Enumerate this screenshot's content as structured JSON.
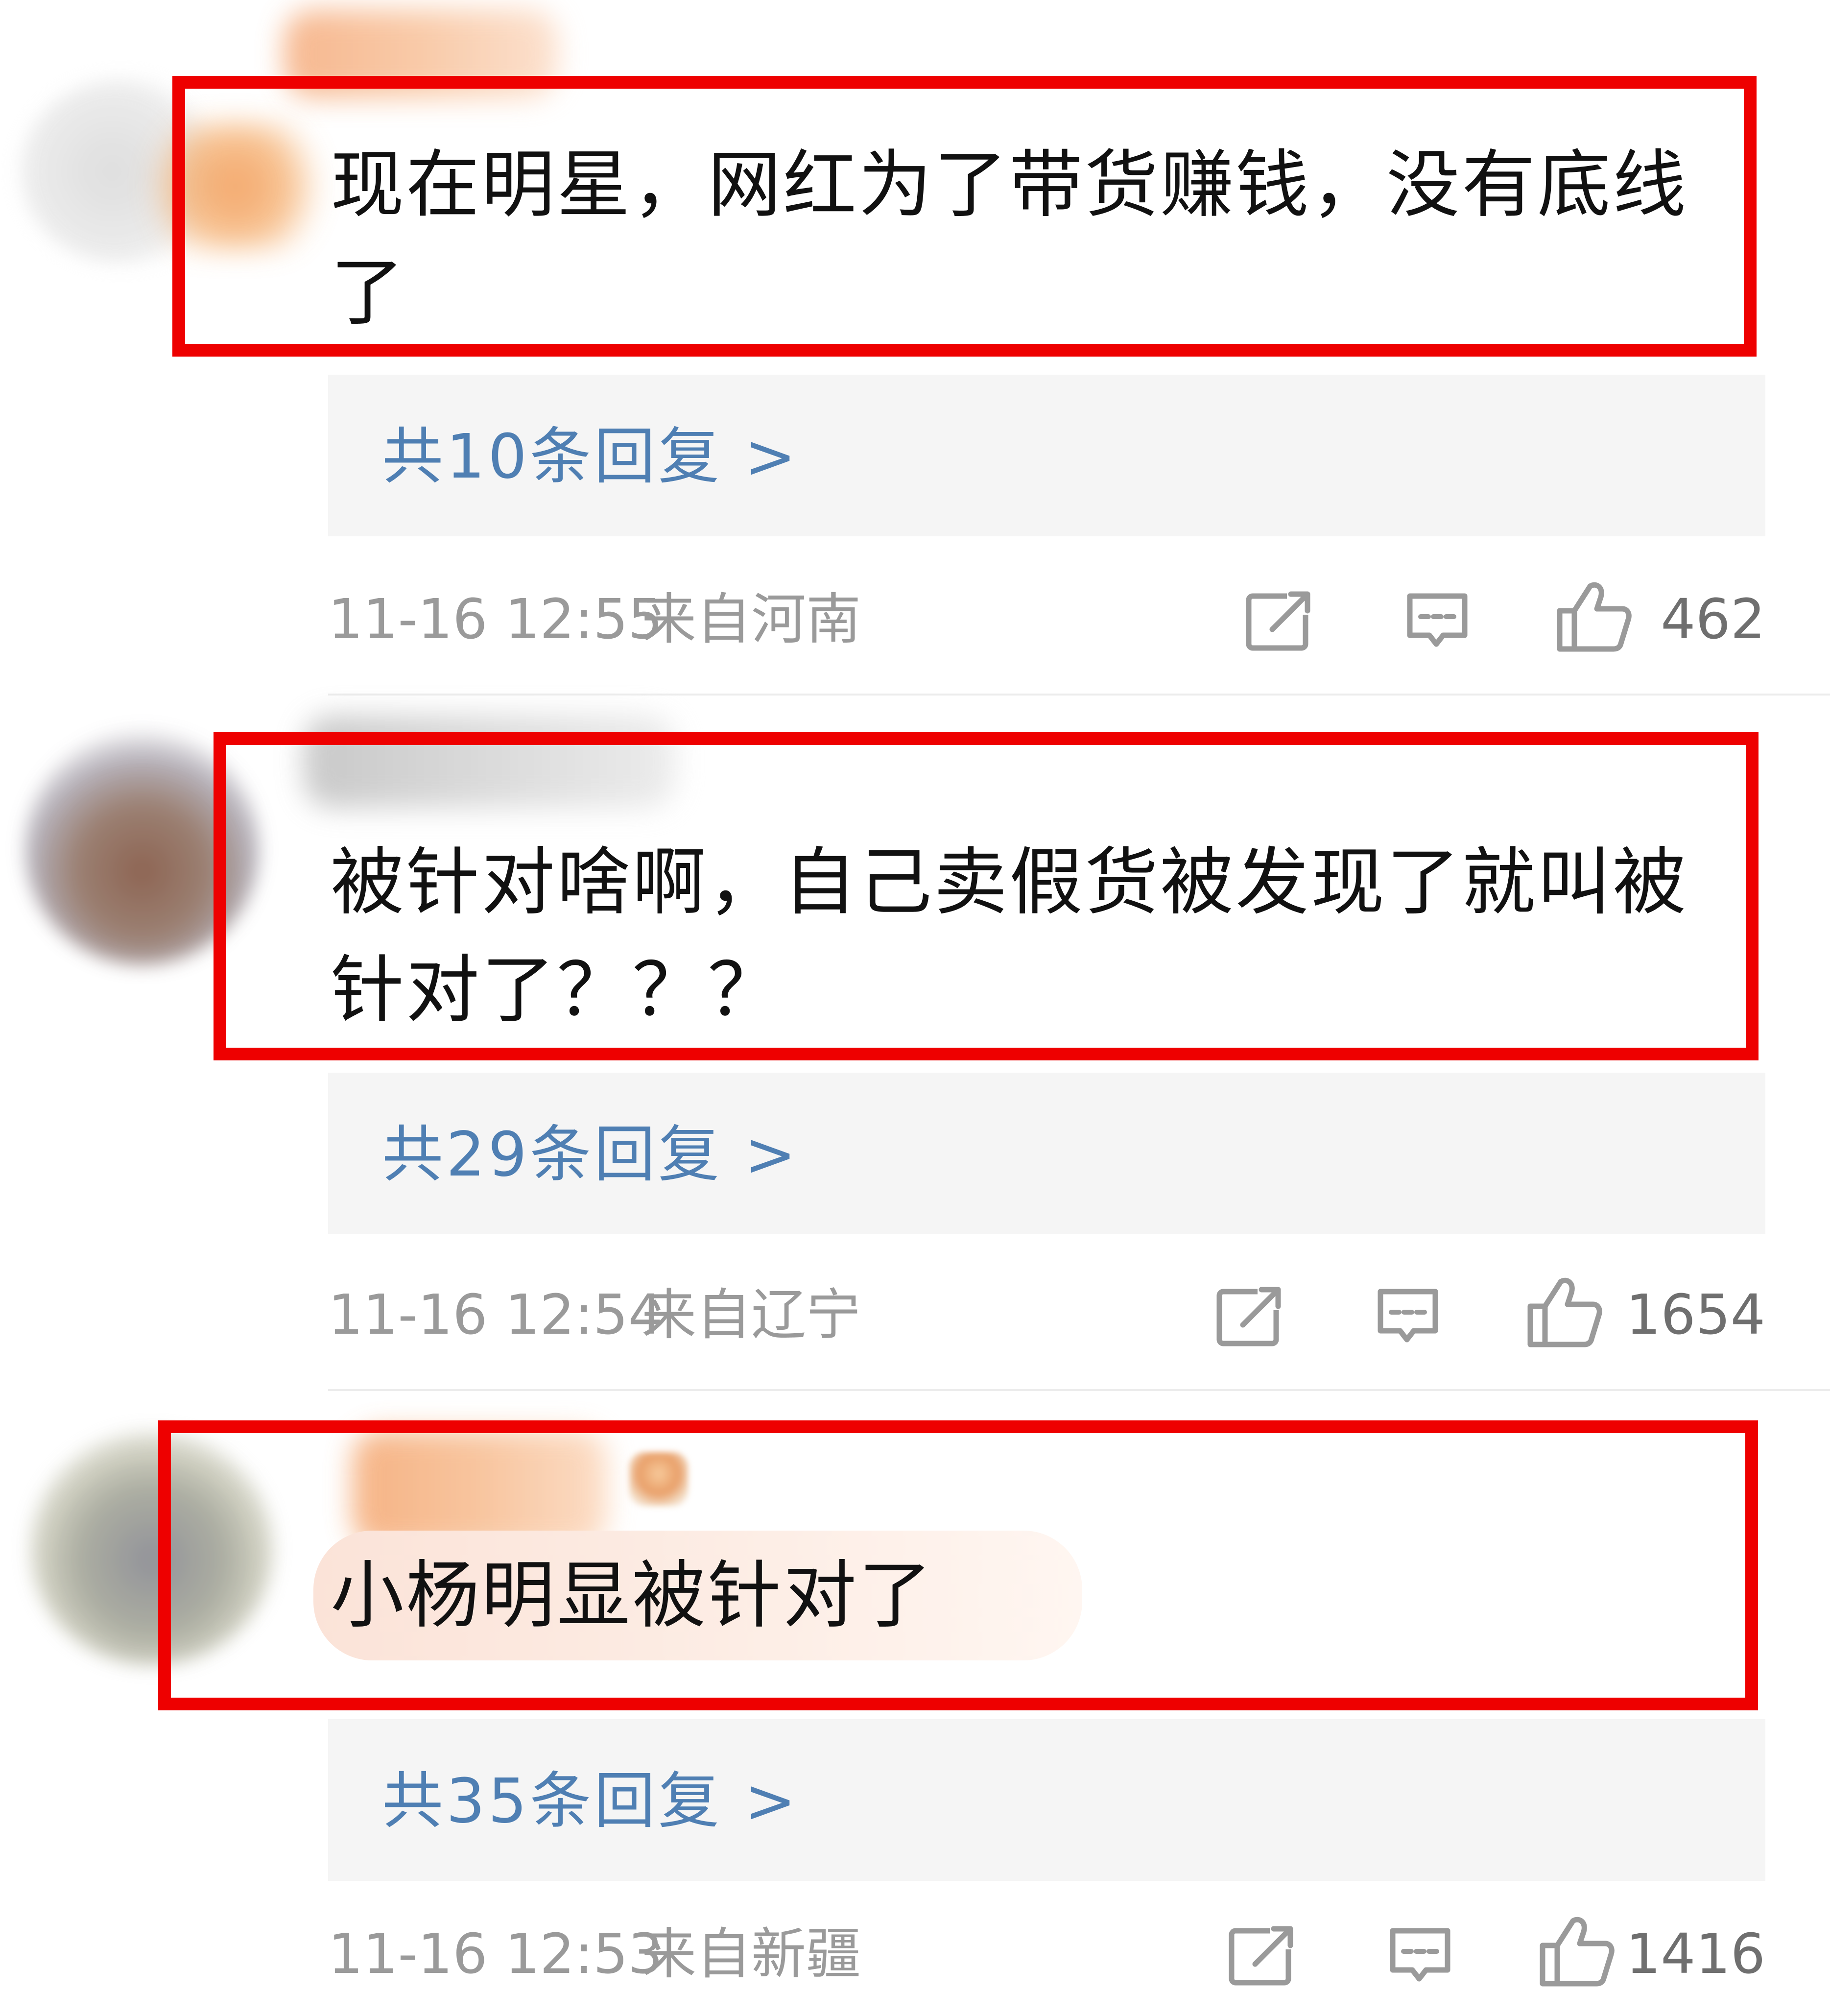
{
  "comments": [
    {
      "text": "现在明星，网红为了带货赚钱，没有底线了",
      "replies_label": "共10条回复 >",
      "time": "11-16 12:55",
      "location": "来自河南",
      "likes": "462",
      "highlighted": true
    },
    {
      "text": "被针对啥啊，自己卖假货被发现了就叫被针对了？？？",
      "replies_label": "共29条回复 >",
      "time": "11-16 12:54",
      "location": "来自辽宁",
      "likes": "1654",
      "highlighted": true
    },
    {
      "text": "小杨明显被针对了",
      "replies_label": "共35条回复 >",
      "time": "11-16 12:53",
      "location": "来自新疆",
      "likes": "1416",
      "highlighted": true
    }
  ],
  "icons": {
    "share": "share-icon",
    "comment": "comment-icon",
    "like": "thumbs-up-icon"
  },
  "colors": {
    "highlight_box": "#ee0000",
    "reply_link": "#4f7fb3",
    "meta_text": "#9a9a9a",
    "reply_bg": "#f5f5f5"
  }
}
